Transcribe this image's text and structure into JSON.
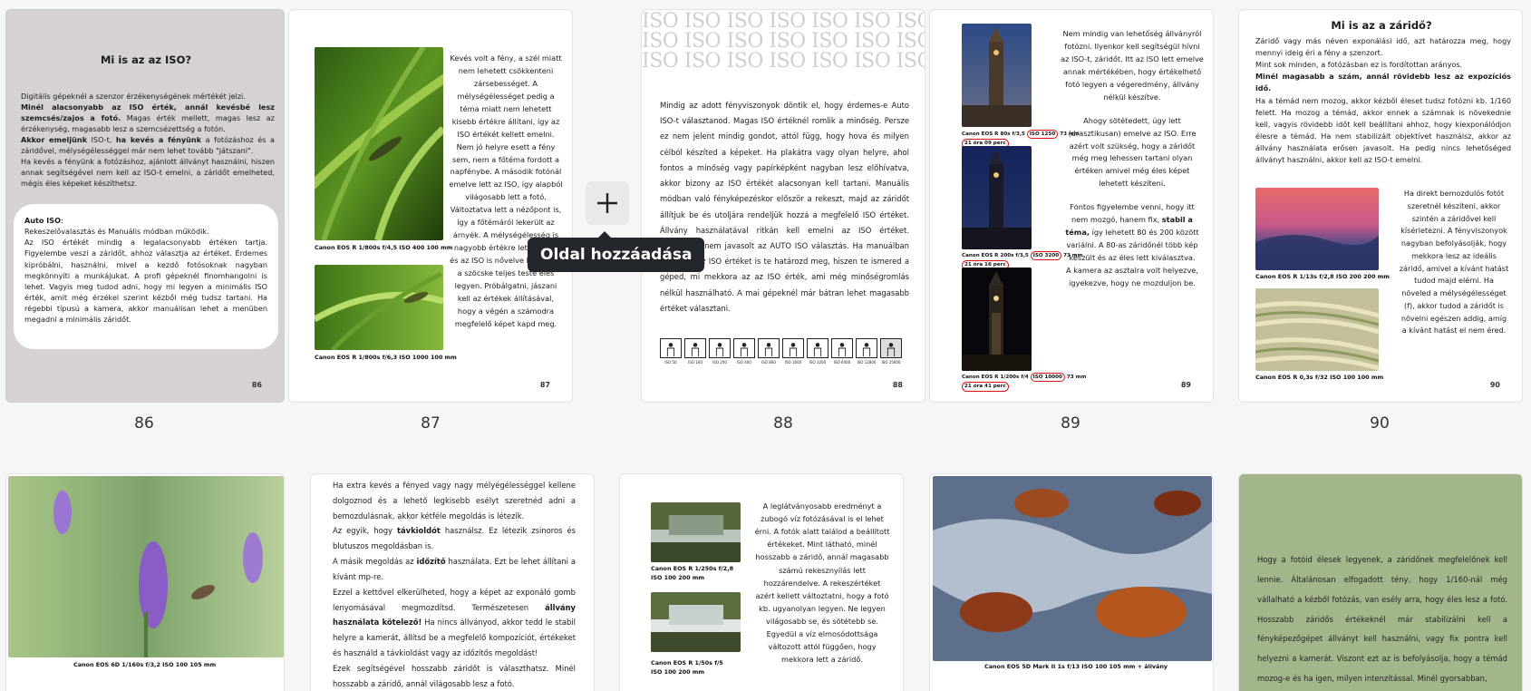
{
  "add_page": {
    "tooltip": "Oldal hozzáadása",
    "icon": "plus-icon"
  },
  "page_labels": [
    "86",
    "87",
    "88",
    "89",
    "90"
  ],
  "p86": {
    "num": "86",
    "title": "Mi is az az ISO?",
    "l1a": "Digitális gépeknél a szenzor érzékenységének mértékét jelzi.",
    "l1b": "Minél alacsonyabb az ISO érték, annál kevésbé lesz szemcsés/zajos a fotó.",
    "l1c": "Magas érték mellett, magas lesz az érzékenység, magasabb lesz a szemcsézettség a fotón.",
    "l2a": "Akkor emeljünk",
    "l2b": "ISO-t,",
    "l2c": "ha kevés a fényünk",
    "l2d": "a fotózáshoz és a záridővel, mélységélességgel már nem lehet tovább \"játszani\".",
    "l3": "Ha kevés a fényünk a fotózáshoz, ajánlott állványt használni, hiszen annak segítségével nem kell az ISO-t emelni, a záridőt emelheted, mégis éles képeket készíthetsz.",
    "box_title": "Auto ISO",
    "box_l1": "Rekeszelővalasztás és Manuális módban működik.",
    "box_l2": "Az ISO értékét mindig a legalacsonyabb értéken tartja. Figyelembe veszi a záridőt, ahhoz választja az értéket. Érdemes kipróbálni, használni, mivel a kezdő fotósoknak nagyban megkönnyíti a munkájukat. A profi gépeknél finomhangolni is lehet. Vagyis meg tudod adni, hogy mi legyen a minimális ISO érték, amit még érzékel szerint kézből még tudsz tartani. Ha régebbi típusú a kamera, akkor manuálisan lehet a menüben megadni a minimális záridőt."
  },
  "p87": {
    "num": "87",
    "cap1": "Canon EOS R 1/800s f/4,5  ISO 400  100 mm",
    "cap2": "Canon EOS R 1/800s f/6,3  ISO 1000  100 mm",
    "text": "Kevés volt a fény, a szél miatt nem lehetett csökkenteni zársebességet. A mélységélességet pedig a téma miatt nem lehetett kisebb értékre állítani, így az ISO értékét kellett emelni. Nem jó helyre esett a fény sem, nem a főtéma fordott a napfénybe. A második fotónál emelve lett az ISO, így alapból világosabb lett a fotó. Változtatva lett a nézőpont is, így a főtémáról lekerült az árnyék. A mélységélesség is nagyobb értékre lett állítva, és az ISO is nővelve lett, hogy a szöcske teljes teste éles legyen. Próbálgatni, jászani kell az értékek állításával, hogy a végén a számodra megfelelő képet kapd meg."
  },
  "p88": {
    "num": "88",
    "banner": "ISO ISO ISO ISO ISO ISO ISO",
    "text": "Mindig az adott fényviszonyok döntik el, hogy érdemes-e Auto ISO-t választanod. Magas ISO értéknél romlik a minőség. Persze ez nem jelent mindig gondot, attól függ, hogy hova és milyen célból készíted a képeket. Ha plakátra vagy olyan helyre, ahol fontos a minőség vagy papírképként nagyban lesz előhívatva, akkor bizony az ISO értékét alacsonyan kell tartani. Manuális módban való fényképezéskor először a rekeszt, majd az záridőt állítjuk be és utoljára rendeljük hozzá a megfelelő ISO értéket. Állvány használatával ritkán kell emelni az ISO értéket. Kezdőknek nem javasolt az AUTO ISO választás. Ha manuálban dolgozol, az ISO értéket is te határozd meg, hiszen te ismered a géped, mi mekkora az az ISO érték, ami még minőségromlás nélkül használható. A mai gépeknél már bátran lehet magasabb értéket választani.",
    "iso_values": [
      "ISO 50",
      "ISO 100",
      "ISO 200",
      "ISO 400",
      "ISO 800",
      "ISO 1600",
      "ISO 3200",
      "ISO 6400",
      "ISO 12800",
      "ISO 25600"
    ]
  },
  "p89": {
    "num": "89",
    "cap1a": "Canon EOS R 80s f/3,5",
    "cap1b": "ISO 1250",
    "cap1c": "73 mm",
    "cap1d": "21 óra 09 perc",
    "cap2a": "Canon EOS R 200s f/3,5",
    "cap2b": "ISO 3200",
    "cap2c": "73 mm",
    "cap2d": "21 óra 16 perc",
    "cap3a": "Canon EOS R 1/200s f/4",
    "cap3b": "ISO 10000",
    "cap3c": "73 mm",
    "cap3d": "21 óra 41 perc",
    "t1": "Nem mindig van lehetőség állványról fotózni. Ilyenkor kell segítségül hívni az ISO-t, záridőt. Itt az ISO lett emelve annak mértékében, hogy értékelhető fotó legyen a végeredmény, állvány nélkül készítve.",
    "t2": "Ahogy sötétedett, úgy lett (drasztikusan) emelve az ISO. Erre azért volt szükség, hogy a záridőt még meg lehessen tartani olyan értéken amivel még éles képet lehetett készíteni.",
    "t3a": "Fontos figyelembe venni, hogy itt nem mozgó, hanem fix,",
    "t3b": "stabil a téma,",
    "t3c": "így lehetett 80 és 200 között variálni. A 80-as záridőnél több kép készült és az éles lett kiválasztva.",
    "t4": "A kamera az asztalra volt helyezve, igyekezve, hogy ne mozduljon be."
  },
  "p90": {
    "num": "90",
    "title": "Mi is az a záridő?",
    "l1": "Záridő vagy más néven exponálási idő, azt határozza meg, hogy mennyi ideig éri a fény a szenzort.",
    "l2": "Mint sok minden, a fotózásban ez is fordítottan arányos.",
    "l3": "Minél magasabb a szám, annál rövidebb lesz az expozíciós idő.",
    "l4": "Ha a témád nem mozog, akkor kézből éleset tudsz fotózni kb. 1/160 felett. Ha mozog a témád, akkor ennek a számnak is növekednie kell, vagyis rövidebb időt kell beállítani ahhoz, hogy kiexponálódjon élesre a témád. Ha nem stabilizált objektívet használsz, akkor az állvány használata erősen javasolt. Ha pedig nincs lehetőséged állványt használni, akkor kell az ISO-t emelni.",
    "cap1": "Canon EOS R 1/13s  f/2,8  ISO 200  200 mm",
    "cap2": "Canon EOS R  0,3s  f/32  ISO 100  100 mm",
    "side": "Ha direkt bemozdulós fotót szeretnél készíteni, akkor szintén a záridővel kell kísérletezni. A fényviszonyok nagyban befolyásolják, hogy mekkora lesz az ideális záridő, amivel a kívánt hatást tudod majd elérni. Ha növeled a mélységélességet (f), akkor tudod a záridőt is növelni egészen addig, amíg a kívánt hatást el nem éred."
  },
  "p91": {
    "cap": "Canon EOS 6D   1/160s  f/3,2  ISO 100  105 mm"
  },
  "p92": {
    "t1": "Ha extra kevés a fényed vagy nagy mélyégélességgel kellene dolgoznod és a lehető legkisebb esélyt szeretnéd adni a bemozdulásnak, akkor kétféle megoldás is létezik.",
    "t2a": "Az egyik, hogy",
    "t2b": "távkioldót",
    "t2c": "használsz. Ez létezik zsinoros és blutuszos megoldásban is.",
    "t3a": "A másik megoldás az",
    "t3b": "időzítő",
    "t3c": "használata. Ezt be lehet állítani a kívánt mp-re.",
    "t4a": "Ezzel a kettővel elkerülheted, hogy a képet az exponáló gomb lenyomásával megmozdítsd. Természetesen",
    "t4b": "állvány használata kötelező!",
    "t4c": "Ha nincs állványod, akkor tedd le stabil helyre a kamerát, állítsd be a megfelelő kompozíciót, értékeket és használd a távkioldást vagy az időzítős megoldást!",
    "t5": "Ezek segítségével hosszabb záridőt is választhatsz. Minél hosszabb a záridő, annál világosabb lesz a fotó."
  },
  "p93": {
    "cap1a": "Canon EOS R 1/250s f/2,8",
    "cap1b": "ISO 100  200 mm",
    "cap2a": "Canon EOS R 1/50s f/5",
    "cap2b": "ISO 100  200 mm",
    "text": "A leglátványosabb eredményt a zubogó víz fotózásával is el lehet érni. A fotók alatt találod a beállított értékeket. Mint látható, minél hosszabb a záridő, annál magasabb számú rekesznyílás lett hozzárendelve. A rekeszértéket azért kellett változtatni, hogy a fotó kb. ugyanolyan legyen. Ne legyen világosabb se, és sötétebb se. Egyedül a víz elmosódottsága változott attól függően, hogy mekkora lett a záridő."
  },
  "p94": {
    "cap": "Canon EOS 5D Mark II  1s  f/13  ISO 100  105 mm + állvány"
  },
  "p95": {
    "text": "Hogy a fotóid élesek legyenek, a záridőnek megfelelőnek kell lennie. Általánosan elfogadott tény, hogy 1/160-nál még vállalható a kézből fotózás, van esély arra, hogy éles lesz a fotó. Hosszabb záridős értékeknél már stabilizálni kell a fényképezőgépet állványt kell használni, vagy fix pontra kell helyezni a kamerát. Viszont ezt az is befolyásolja, hogy a témád mozog-e és ha igen, milyen intenzitással. Minél gyorsabban,"
  }
}
